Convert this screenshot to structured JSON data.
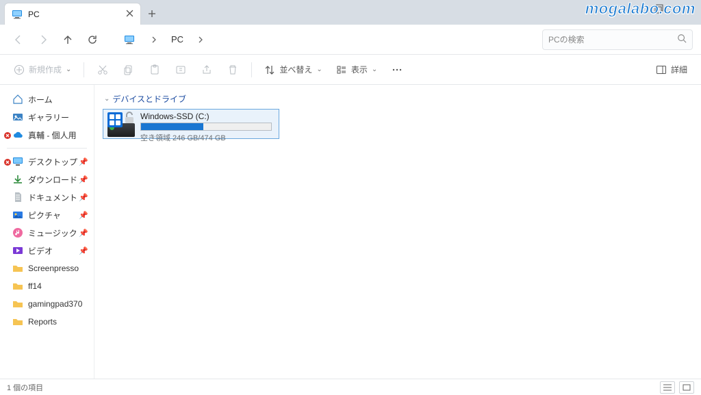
{
  "tab": {
    "title": "PC"
  },
  "nav": {
    "breadcrumb_text": "PC",
    "search_placeholder": "PCの検索"
  },
  "toolbar": {
    "new_label": "新規作成",
    "sort_label": "並べ替え",
    "view_label": "表示",
    "details_label": "詳細"
  },
  "sidebar": {
    "home": "ホーム",
    "gallery": "ギャラリー",
    "onedrive": "真輔 - 個人用",
    "desktop": "デスクトップ",
    "downloads": "ダウンロード",
    "documents": "ドキュメント",
    "pictures": "ピクチャ",
    "music": "ミュージック",
    "videos": "ビデオ",
    "folders": [
      "Screenpresso",
      "ff14",
      "gamingpad370",
      "Reports"
    ]
  },
  "main": {
    "group_header": "デバイスとドライブ",
    "drive": {
      "name": "Windows-SSD (C:)",
      "sub": "空き領域 246 GB/474 GB",
      "used_pct": 48
    }
  },
  "status": {
    "text": "1 個の項目"
  },
  "watermark": "mogalabo.com"
}
